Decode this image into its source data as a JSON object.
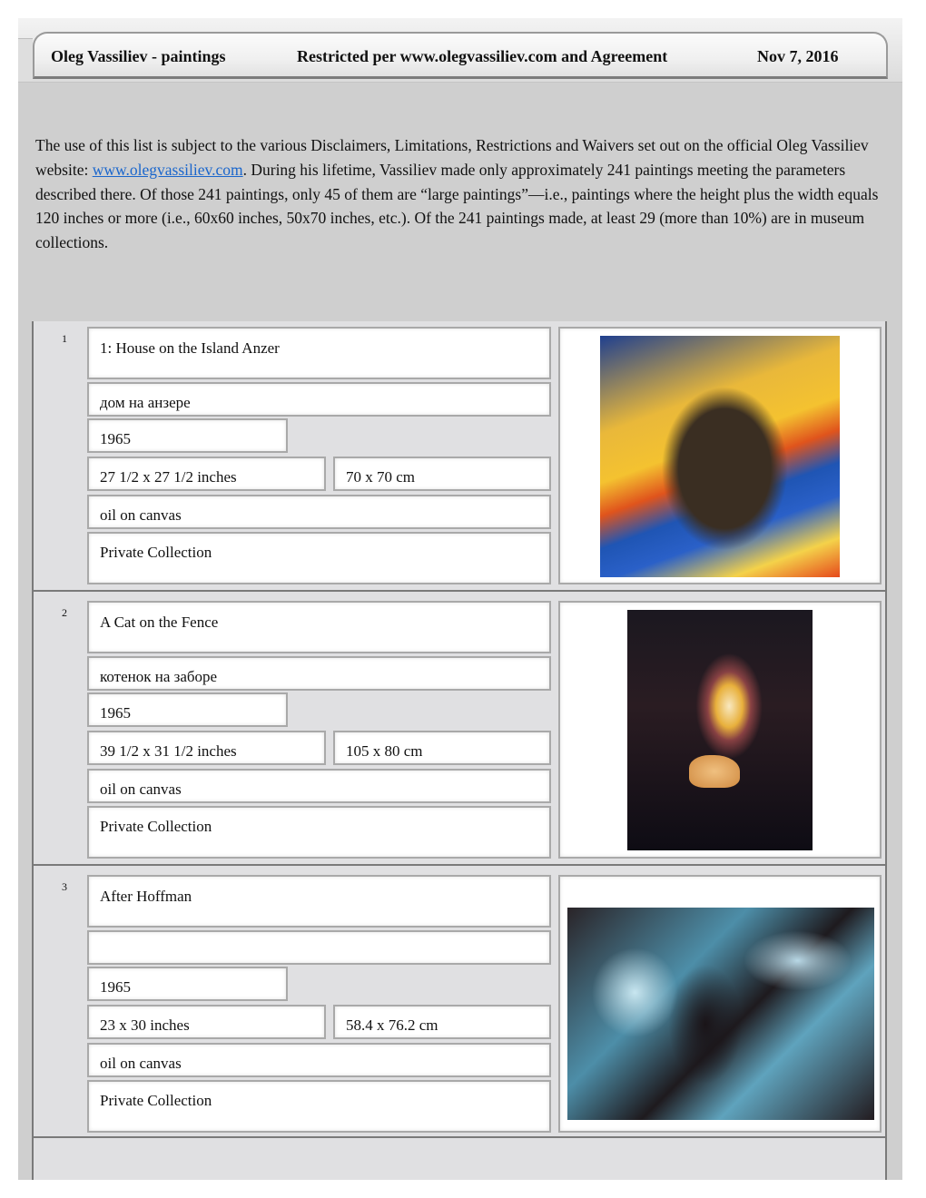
{
  "header": {
    "title": "Oleg Vassiliev - paintings",
    "restriction": "Restricted per www.olegvassiliev.com and Agreement",
    "date": "Nov 7, 2016"
  },
  "intro": {
    "text_before_link": "The use of this list is subject to the various Disclaimers, Limitations, Restrictions and Waivers set out on the official Oleg Vassiliev website:  ",
    "link_text": "www.olegvassiliev.com",
    "text_after_link": ".  During his lifetime, Vassiliev made only approximately 241 paintings meeting the parameters described there.  Of those 241 paintings, only 45 of them are “large paintings”—i.e., paintings where the height plus the width equals 120 inches or more (i.e., 60x60 inches, 50x70 inches, etc.).  Of the 241 paintings made, at least 29 (more than 10%) are in museum collections."
  },
  "paintings": [
    {
      "number": "1",
      "title": "1: House on the Island Anzer",
      "russian_title": "дом на анзере",
      "year": "1965",
      "size_inches": "27 1/2 x 27 1/2 inches",
      "size_cm": "70 x 70 cm",
      "medium": "oil on canvas",
      "collection": "Private Collection",
      "image": "painting of a dark house on an island with radiating yellow, orange and blue light"
    },
    {
      "number": "2",
      "title": "A Cat on the Fence",
      "russian_title": "котенок на заборе",
      "year": "1965",
      "size_inches": "39 1/2 x 31 1/2 inches",
      "size_cm": "105 x 80 cm",
      "medium": "oil on canvas",
      "collection": "Private Collection",
      "image": "dark painting of a ginger kitten on a fence with a glowing doorway and figure"
    },
    {
      "number": "3",
      "title": "After Hoffman",
      "russian_title": "",
      "year": "1965",
      "size_inches": "23 x 30 inches",
      "size_cm": "58.4 x 76.2 cm",
      "medium": "oil on canvas",
      "collection": "Private Collection",
      "image": "expressive dark blue and black painting of a figure in a turbulent landscape"
    }
  ]
}
